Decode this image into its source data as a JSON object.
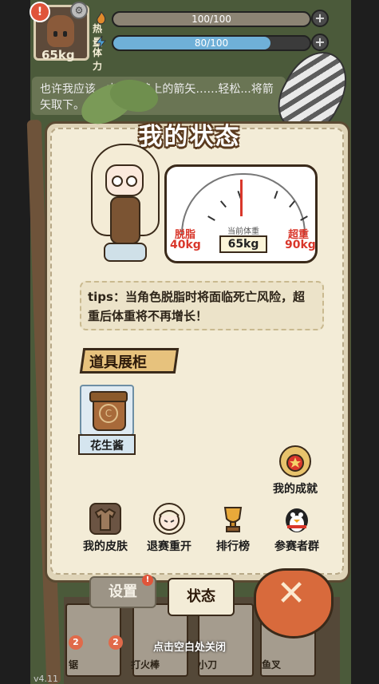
{
  "hud": {
    "weight": "65kg",
    "alert": "!",
    "heat_label": "热量",
    "heat_value": "100/100",
    "heat_fill": 1.0,
    "stamina_label": "体力",
    "stamina_value": "80/100",
    "stamina_fill": 0.8,
    "plus": "+"
  },
  "background_hint": "也许我应该...中箭松鸡上的箭矢……轻松...将箭矢取下。",
  "panel": {
    "title": "我的状态",
    "scale": {
      "center_label": "当前体重",
      "current_weight": "65kg",
      "low_label": "脱脂",
      "low_value": "40kg",
      "high_label": "超重",
      "high_value": "90kg"
    },
    "tips": "tips：当角色脱脂时将面临死亡风险，超重后体重将不再增长！",
    "showcase_title": "道具展柜",
    "items": [
      {
        "name": "花生酱",
        "icon": "peanut-butter-jar-icon",
        "mark": "C"
      }
    ],
    "functions": [
      {
        "label": "我的成就",
        "icon": "medal-icon"
      },
      {
        "label": "我的皮肤",
        "icon": "clothes-icon"
      },
      {
        "label": "退赛重开",
        "icon": "restart-character-icon"
      },
      {
        "label": "排行榜",
        "icon": "trophy-icon"
      },
      {
        "label": "参赛者群",
        "icon": "penguin-icon"
      }
    ]
  },
  "tabs": {
    "settings": "设置",
    "settings_badge": "!",
    "status": "状态",
    "close": "✕"
  },
  "bottom_slots": [
    {
      "num": "2",
      "name": "锯"
    },
    {
      "num": "2",
      "name": "打火棒"
    },
    {
      "num": "",
      "name": "小刀"
    },
    {
      "num": "",
      "name": "鱼叉"
    }
  ],
  "close_hint": "点击空白处关闭",
  "version": "v4.11",
  "colors": {
    "heat_bar": "#8c8474",
    "stamina_bar": "#6fb0d8",
    "accent_red": "#d9372b",
    "panel_bg": "#f3ecd7"
  }
}
